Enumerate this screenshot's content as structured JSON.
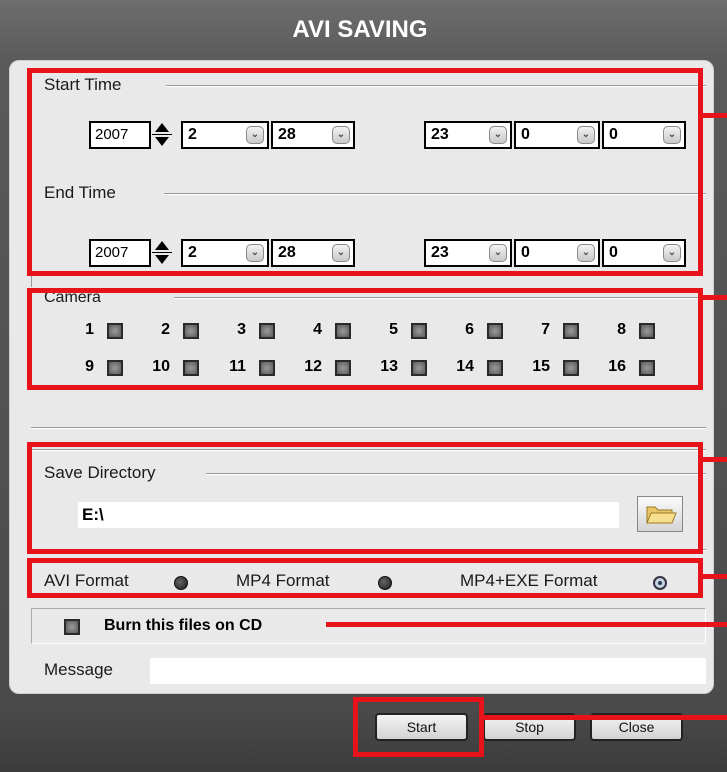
{
  "window": {
    "title": "AVI SAVING"
  },
  "start_time": {
    "label": "Start Time",
    "year": "2007",
    "month": "2",
    "day": "28",
    "hour": "23",
    "minute": "0",
    "second": "0"
  },
  "end_time": {
    "label": "End Time",
    "year": "2007",
    "month": "2",
    "day": "28",
    "hour": "23",
    "minute": "0",
    "second": "0"
  },
  "camera": {
    "label": "Camera",
    "channels": [
      "1",
      "2",
      "3",
      "4",
      "5",
      "6",
      "7",
      "8",
      "9",
      "10",
      "11",
      "12",
      "13",
      "14",
      "15",
      "16"
    ]
  },
  "save_directory": {
    "label": "Save Directory",
    "value": "E:\\"
  },
  "formats": {
    "avi_label": "AVI Format",
    "mp4_label": "MP4 Format",
    "mp4exe_label": "MP4+EXE Format",
    "selected": "MP4+EXE Format"
  },
  "burn_cd": {
    "label": "Burn this files on CD"
  },
  "message": {
    "label": "Message",
    "value": ""
  },
  "buttons": {
    "start": "Start",
    "stop": "Stop",
    "close": "Close"
  },
  "colors": {
    "highlight": "#e8121b",
    "background": "#4a4a4a",
    "panel": "#e9e9e9"
  }
}
